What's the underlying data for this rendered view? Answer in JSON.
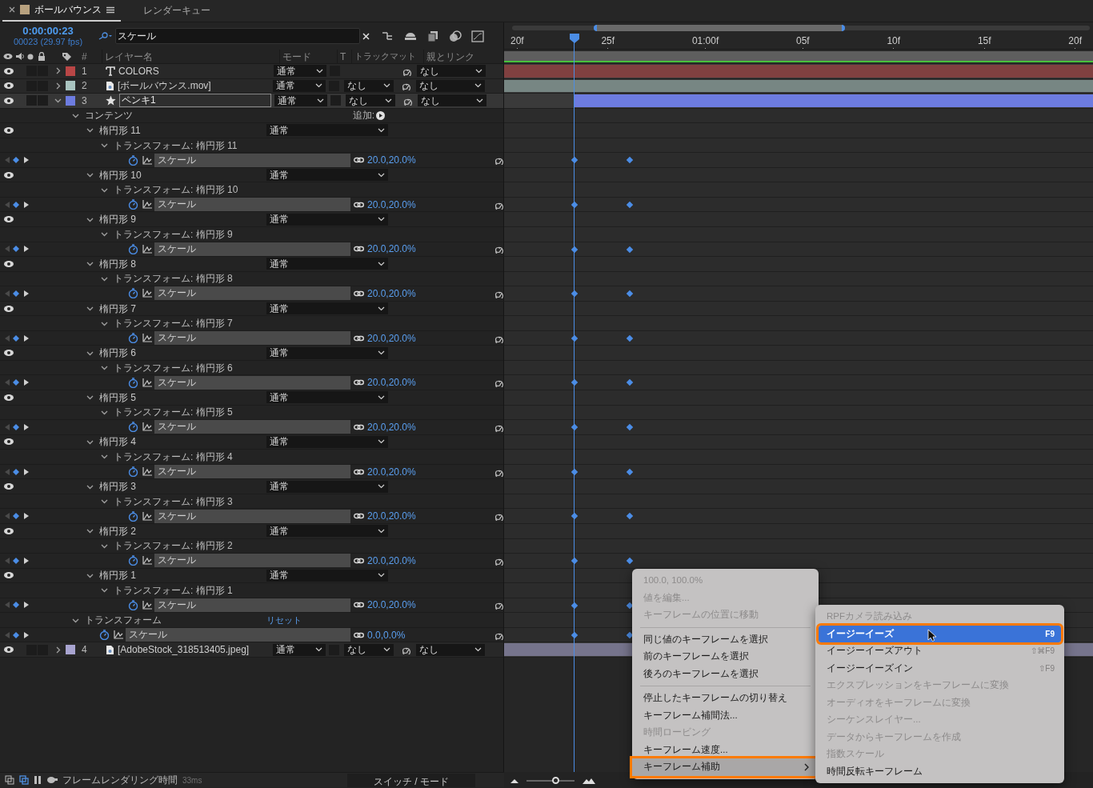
{
  "tabs": [
    {
      "label": "ボールバウンス",
      "selected": true,
      "color": "#b8a27f"
    },
    {
      "label": "レンダーキュー",
      "selected": false
    }
  ],
  "timecode": "0:00:00:23",
  "frame_count": "00023 (29.97 fps)",
  "search": {
    "value": "スケール"
  },
  "columns": [
    "#",
    "レイヤー名",
    "モード",
    "T",
    "トラックマット",
    "親とリンク"
  ],
  "ruler": {
    "ticks": [
      "20f",
      "25f",
      "01:00f",
      "05f",
      "10f",
      "15f",
      "20f"
    ]
  },
  "layers": [
    {
      "kind": "layer",
      "number": "1",
      "name": "COLORS",
      "type_icon": {
        "kind": "text"
      },
      "color": "#b94646",
      "visible": true,
      "expanded": false,
      "selected": false,
      "editing": false,
      "mode": "通常",
      "parent": "なし"
    },
    {
      "kind": "layer",
      "number": "2",
      "name": "[ボールバウンス.mov]",
      "type_icon": {
        "kind": "footage"
      },
      "color": "#a9c4c0",
      "visible": true,
      "expanded": false,
      "selected": false,
      "editing": false,
      "mode": "通常",
      "track_matte": "なし",
      "parent": "なし"
    },
    {
      "kind": "layer",
      "number": "3",
      "name": "ペンキ1",
      "type_icon": {
        "kind": "shape"
      },
      "color": "#6d7ce0",
      "visible": true,
      "expanded": true,
      "selected": true,
      "editing": true,
      "mode": "通常",
      "track_matte": "なし",
      "parent": "なし",
      "children": [
        {
          "kind": "group",
          "name": "コンテンツ",
          "expanded": true,
          "add_label": "追加:",
          "children": [
            {
              "kind": "shape",
              "name": "楕円形 11",
              "visible": true,
              "expanded": true,
              "mode": "通常",
              "children": [
                {
                  "kind": "transform",
                  "name": "トランスフォーム: 楕円形 11",
                  "expanded": true,
                  "children": [
                    {
                      "kind": "property",
                      "name": "スケール",
                      "value": "20.0,20.0%"
                    }
                  ]
                }
              ]
            },
            {
              "kind": "shape",
              "name": "楕円形 10",
              "visible": true,
              "expanded": true,
              "mode": "通常",
              "children": [
                {
                  "kind": "transform",
                  "name": "トランスフォーム: 楕円形 10",
                  "expanded": true,
                  "children": [
                    {
                      "kind": "property",
                      "name": "スケール",
                      "value": "20.0,20.0%"
                    }
                  ]
                }
              ]
            },
            {
              "kind": "shape",
              "name": "楕円形 9",
              "visible": true,
              "expanded": true,
              "mode": "通常",
              "children": [
                {
                  "kind": "transform",
                  "name": "トランスフォーム: 楕円形 9",
                  "expanded": true,
                  "children": [
                    {
                      "kind": "property",
                      "name": "スケール",
                      "value": "20.0,20.0%"
                    }
                  ]
                }
              ]
            },
            {
              "kind": "shape",
              "name": "楕円形 8",
              "visible": true,
              "expanded": true,
              "mode": "通常",
              "children": [
                {
                  "kind": "transform",
                  "name": "トランスフォーム: 楕円形 8",
                  "expanded": true,
                  "children": [
                    {
                      "kind": "property",
                      "name": "スケール",
                      "value": "20.0,20.0%"
                    }
                  ]
                }
              ]
            },
            {
              "kind": "shape",
              "name": "楕円形 7",
              "visible": true,
              "expanded": true,
              "mode": "通常",
              "children": [
                {
                  "kind": "transform",
                  "name": "トランスフォーム: 楕円形 7",
                  "expanded": true,
                  "children": [
                    {
                      "kind": "property",
                      "name": "スケール",
                      "value": "20.0,20.0%"
                    }
                  ]
                }
              ]
            },
            {
              "kind": "shape",
              "name": "楕円形 6",
              "visible": true,
              "expanded": true,
              "mode": "通常",
              "children": [
                {
                  "kind": "transform",
                  "name": "トランスフォーム: 楕円形 6",
                  "expanded": true,
                  "children": [
                    {
                      "kind": "property",
                      "name": "スケール",
                      "value": "20.0,20.0%"
                    }
                  ]
                }
              ]
            },
            {
              "kind": "shape",
              "name": "楕円形 5",
              "visible": true,
              "expanded": true,
              "mode": "通常",
              "children": [
                {
                  "kind": "transform",
                  "name": "トランスフォーム: 楕円形 5",
                  "expanded": true,
                  "children": [
                    {
                      "kind": "property",
                      "name": "スケール",
                      "value": "20.0,20.0%"
                    }
                  ]
                }
              ]
            },
            {
              "kind": "shape",
              "name": "楕円形 4",
              "visible": true,
              "expanded": true,
              "mode": "通常",
              "children": [
                {
                  "kind": "transform",
                  "name": "トランスフォーム: 楕円形 4",
                  "expanded": true,
                  "children": [
                    {
                      "kind": "property",
                      "name": "スケール",
                      "value": "20.0,20.0%"
                    }
                  ]
                }
              ]
            },
            {
              "kind": "shape",
              "name": "楕円形 3",
              "visible": true,
              "expanded": true,
              "mode": "通常",
              "children": [
                {
                  "kind": "transform",
                  "name": "トランスフォーム: 楕円形 3",
                  "expanded": true,
                  "children": [
                    {
                      "kind": "property",
                      "name": "スケール",
                      "value": "20.0,20.0%"
                    }
                  ]
                }
              ]
            },
            {
              "kind": "shape",
              "name": "楕円形 2",
              "visible": true,
              "expanded": true,
              "mode": "通常",
              "children": [
                {
                  "kind": "transform",
                  "name": "トランスフォーム: 楕円形 2",
                  "expanded": true,
                  "children": [
                    {
                      "kind": "property",
                      "name": "スケール",
                      "value": "20.0,20.0%"
                    }
                  ]
                }
              ]
            },
            {
              "kind": "shape",
              "name": "楕円形 1",
              "visible": true,
              "expanded": true,
              "mode": "通常",
              "children": [
                {
                  "kind": "transform",
                  "name": "トランスフォーム: 楕円形 1",
                  "expanded": true,
                  "children": [
                    {
                      "kind": "property",
                      "name": "スケール",
                      "value": "20.0,20.0%"
                    }
                  ]
                }
              ]
            }
          ]
        },
        {
          "kind": "transform",
          "name": "トランスフォーム",
          "expanded": true,
          "reset": "リセット",
          "children": [
            {
              "kind": "property",
              "name": "スケール",
              "value": "0.0,0.0%"
            }
          ]
        }
      ]
    },
    {
      "kind": "layer",
      "number": "4",
      "name": "[AdobeStock_318513405.jpeg]",
      "type_icon": {
        "kind": "footage"
      },
      "color": "#a8a4d0",
      "visible": true,
      "expanded": false,
      "selected": false,
      "editing": false,
      "mode": "通常",
      "track_matte": "なし",
      "parent": "なし"
    }
  ],
  "context_menu": {
    "items": [
      {
        "kind": "item",
        "label": "100.0, 100.0%",
        "disabled": true,
        "selected": false
      },
      {
        "kind": "item",
        "label": "値を編集...",
        "disabled": true,
        "selected": false
      },
      {
        "kind": "item",
        "label": "キーフレームの位置に移動",
        "disabled": true,
        "selected": false
      },
      {
        "kind": "separator"
      },
      {
        "kind": "item",
        "label": "同じ値のキーフレームを選択",
        "disabled": false,
        "selected": false
      },
      {
        "kind": "item",
        "label": "前のキーフレームを選択",
        "disabled": false,
        "selected": false
      },
      {
        "kind": "item",
        "label": "後ろのキーフレームを選択",
        "disabled": false,
        "selected": false
      },
      {
        "kind": "separator"
      },
      {
        "kind": "item",
        "label": "停止したキーフレームの切り替え",
        "disabled": false,
        "selected": false
      },
      {
        "kind": "item",
        "label": "キーフレーム補間法...",
        "disabled": false,
        "selected": false
      },
      {
        "kind": "item",
        "label": "時間ロービング",
        "disabled": true,
        "selected": false
      },
      {
        "kind": "item",
        "label": "キーフレーム速度...",
        "disabled": false,
        "selected": false
      },
      {
        "kind": "item",
        "label": "キーフレーム補助",
        "disabled": false,
        "selected": true,
        "callout": true,
        "submenu": true
      }
    ]
  },
  "submenu": {
    "items": [
      {
        "kind": "item",
        "label": "RPFカメラ読み込み",
        "disabled": true,
        "selected": false
      },
      {
        "kind": "item",
        "label": "イージーイーズ",
        "shortcut": "F9",
        "disabled": false,
        "selected": true,
        "callout": true,
        "cursor": true
      },
      {
        "kind": "item",
        "label": "イージーイーズアウト",
        "shortcut": "⇧⌘F9",
        "disabled": false,
        "selected": false
      },
      {
        "kind": "item",
        "label": "イージーイーズイン",
        "shortcut": "⇧F9",
        "disabled": false,
        "selected": false
      },
      {
        "kind": "item",
        "label": "エクスプレッションをキーフレームに変換",
        "disabled": true,
        "selected": false
      },
      {
        "kind": "item",
        "label": "オーディオをキーフレームに変換",
        "disabled": true,
        "selected": false
      },
      {
        "kind": "item",
        "label": "シーケンスレイヤー...",
        "disabled": true,
        "selected": false
      },
      {
        "kind": "item",
        "label": "データからキーフレームを作成",
        "disabled": true,
        "selected": false
      },
      {
        "kind": "item",
        "label": "指数スケール",
        "disabled": true,
        "selected": false
      },
      {
        "kind": "item",
        "label": "時間反転キーフレーム",
        "disabled": false,
        "selected": false
      }
    ]
  },
  "status_bar": {
    "label": "フレームレンダリング時間",
    "render_time": "33ms",
    "toggle": "スイッチ / モード",
    "zoom": {
      "level": 0.6
    }
  }
}
